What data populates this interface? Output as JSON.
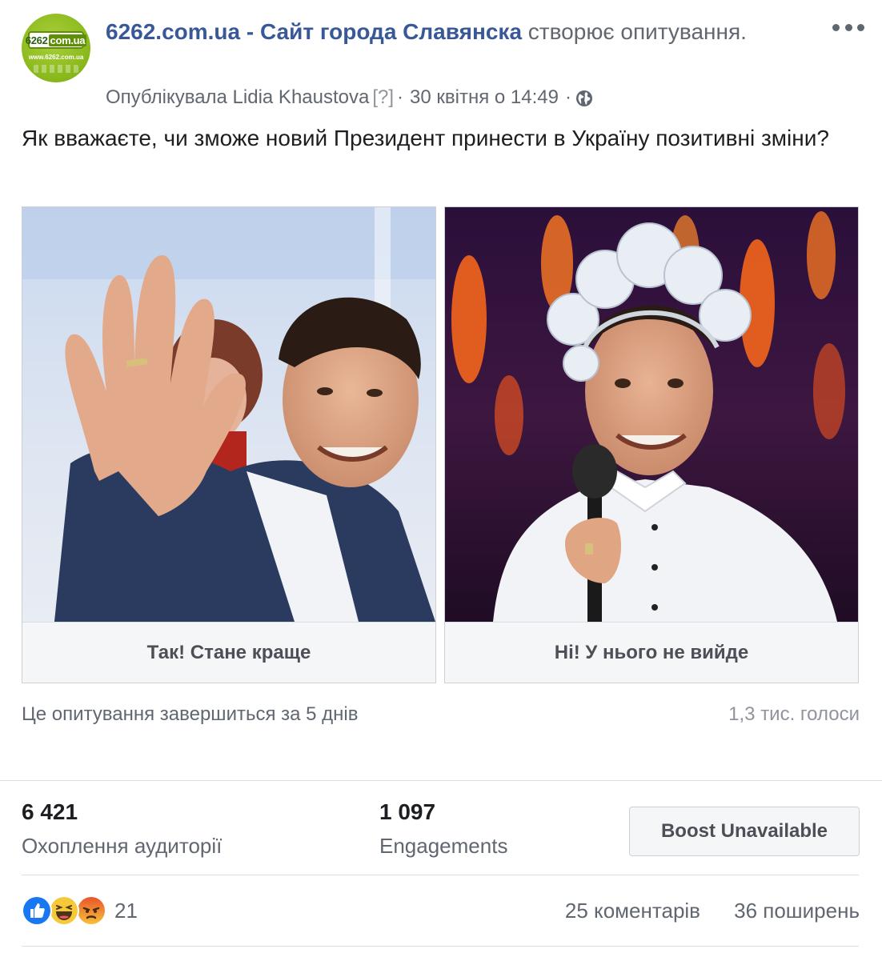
{
  "post": {
    "page_name": "6262.com.ua - Сайт города Славянска",
    "action_text": "створює опитування.",
    "published_by": "Опублікувала Lidia Khaustova",
    "help_marker": "[?]",
    "separator": "·",
    "timestamp": "30 квітня о 14:49",
    "privacy_icon": "globe-icon",
    "text": "Як вважаєте, чи зможе новий Президент принести в Україну позитивні зміни?"
  },
  "avatar": {
    "logo_left": "6262",
    "logo_right": "com.ua",
    "logo_url": "www.6262.com.ua",
    "color": "#8dbb1f"
  },
  "poll": {
    "options": [
      {
        "label": "Так! Стане краще"
      },
      {
        "label": "Ні! У нього не вийде"
      }
    ],
    "ends_text": "Це опитування завершиться за 5 днів",
    "votes_text": "1,3 тис. голоси"
  },
  "stats": {
    "reach_value": "6 421",
    "reach_label": "Охоплення аудиторії",
    "engagements_value": "1 097",
    "engagements_label": "Engagements"
  },
  "boost": {
    "label": "Boost Unavailable"
  },
  "reactions": {
    "icons": [
      "like-icon",
      "haha-icon",
      "angry-icon"
    ],
    "count": "21",
    "comments": "25 коментарів",
    "shares": "36 поширень"
  },
  "colors": {
    "link": "#385898",
    "secondary_text": "#606770",
    "like": "#1877f2"
  }
}
